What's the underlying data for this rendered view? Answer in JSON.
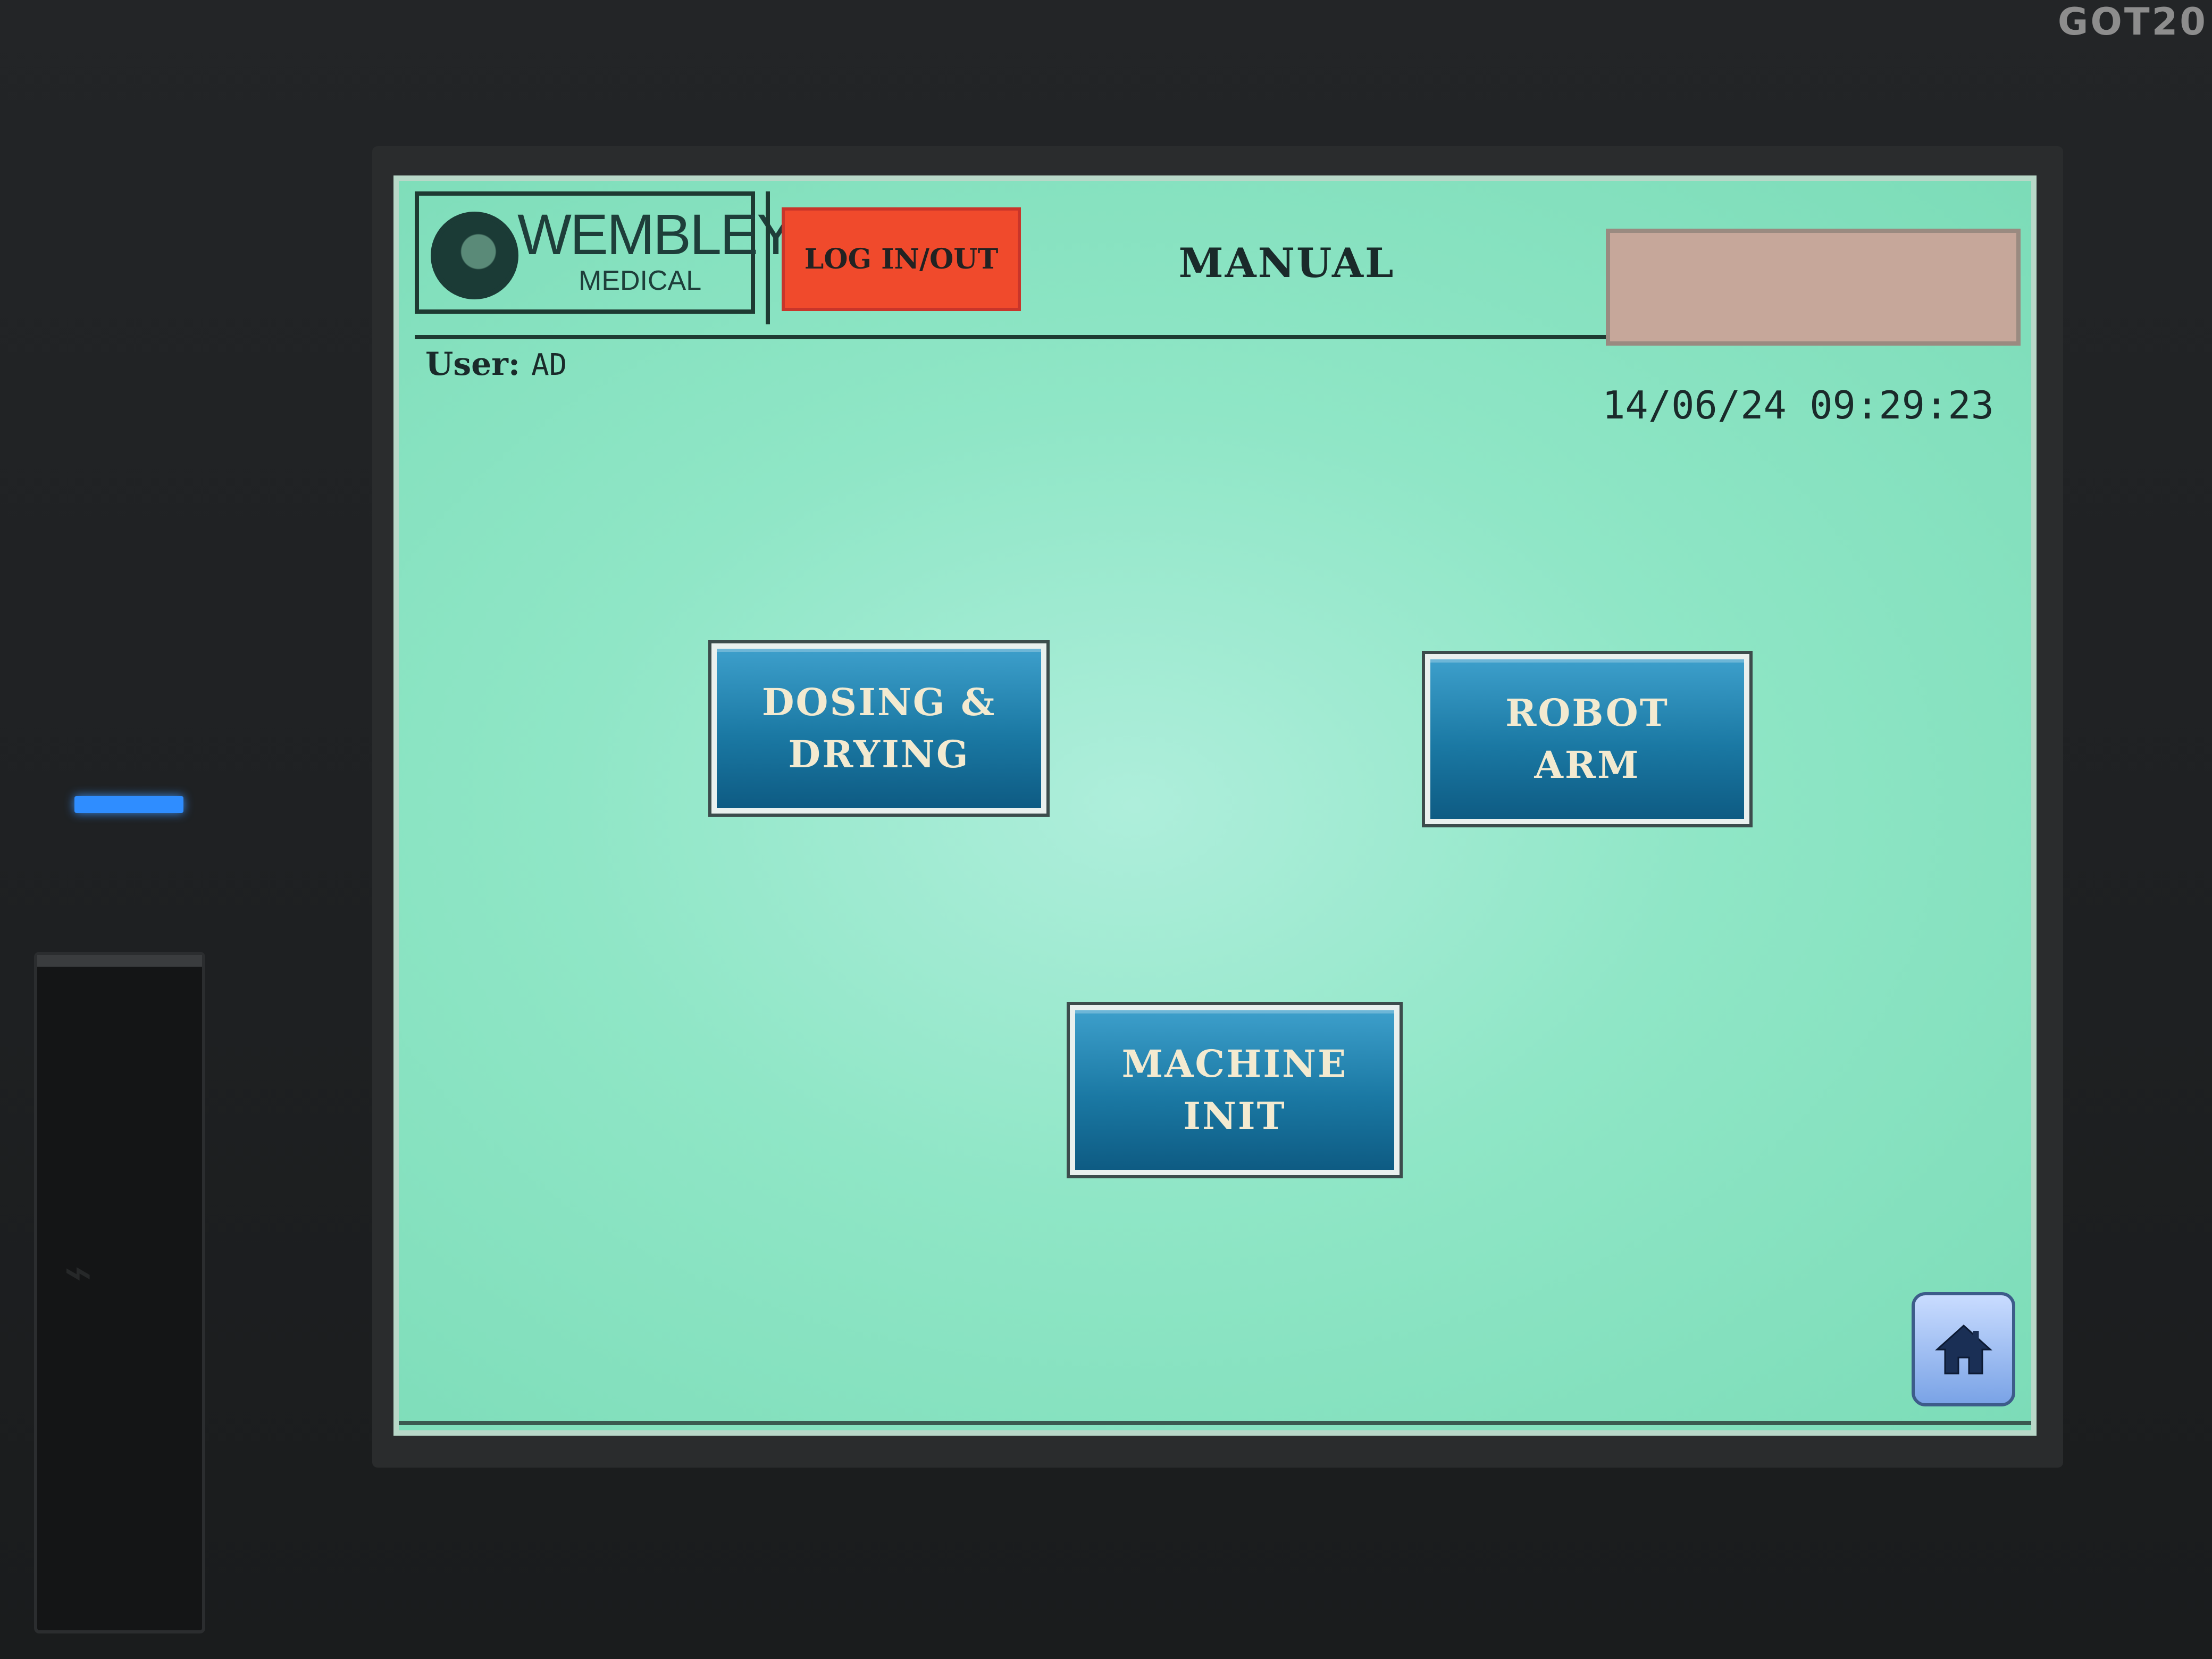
{
  "device": {
    "brand_label": "GOT20"
  },
  "header": {
    "logo_name": "WEMBLEY",
    "logo_sub": "MEDICAL",
    "login_label": "LOG IN/OUT",
    "page_title": "MANUAL"
  },
  "status": {
    "user_label": "User:",
    "user_value": "AD",
    "datetime": "14/06/24 09:29:23"
  },
  "buttons": {
    "dosing_drying": "DOSING &\nDRYING",
    "robot_arm": "ROBOT\nARM",
    "machine_init": "MACHINE\nINIT"
  },
  "icons": {
    "home": "home-icon",
    "logo": "wembley-logo-icon"
  },
  "colors": {
    "screen_bg": "#8fe6c6",
    "login_btn": "#f04a2c",
    "nav_btn": "#1a78a3",
    "status_panel": "#c6a79a",
    "power_led": "#2f8dff"
  }
}
